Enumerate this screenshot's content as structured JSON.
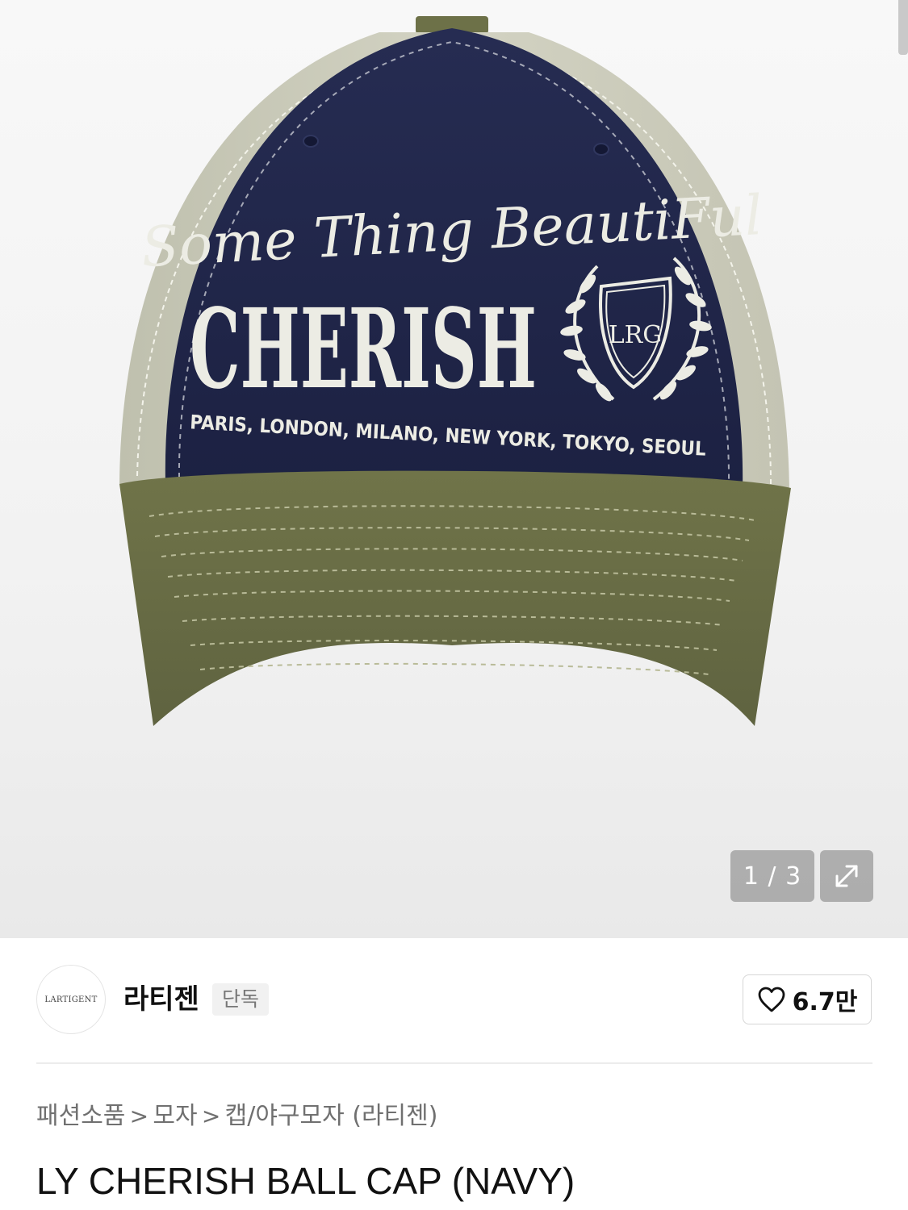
{
  "image_viewer": {
    "counter": "1 / 3",
    "expand_icon": "expand-arrows-icon"
  },
  "product_image": {
    "embroidery_script": "Some Thing BeautiFul",
    "embroidery_main": "CHERISH",
    "embroidery_cities": "PARIS, LONDON, MILANO, NEW YORK, TOKYO, SEOUL",
    "crest_letters": "LRG",
    "colors": {
      "crown": "#1f2547",
      "side_panels": "#cfcfbf",
      "brim": "#6d7148",
      "embroidery": "#e8e8e0"
    }
  },
  "brand": {
    "logo_text": "LARTIGENT",
    "name": "라티젠",
    "badge": "단독"
  },
  "like": {
    "icon": "heart-icon",
    "count": "6.7만"
  },
  "breadcrumb": {
    "items": [
      "패션소품",
      "모자",
      "캡/야구모자 (라티젠)"
    ],
    "separator": ">"
  },
  "product": {
    "title": "LY CHERISH BALL CAP (NAVY)"
  }
}
